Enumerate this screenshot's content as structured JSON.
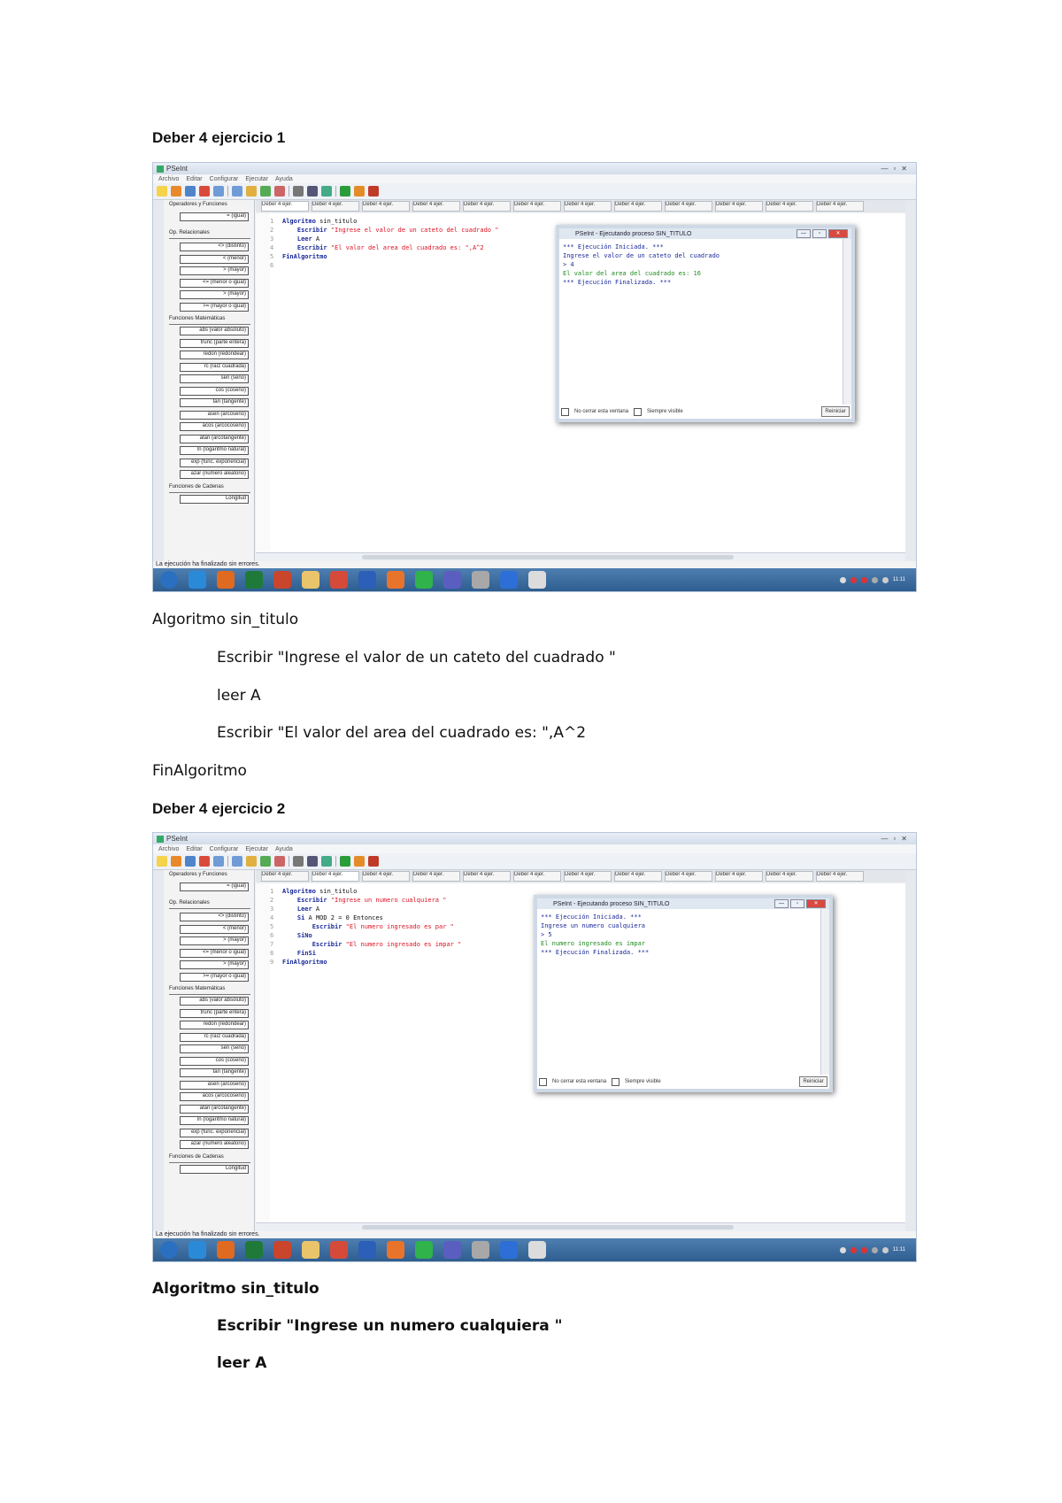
{
  "heading1": "Deber 4 ejercicio 1",
  "heading2": "Deber 4 ejercicio 2",
  "shot1": {
    "app_title": "PSeInt",
    "window_controls": [
      "—",
      "▫",
      "✕"
    ],
    "menu": [
      "Archivo",
      "Editar",
      "Configurar",
      "Ejecutar",
      "Ayuda"
    ],
    "tabs": [
      "Deber 4 ejer.",
      "Deber 4 ejer.",
      "Deber 4 ejer.",
      "Deber 4 ejer.",
      "Deber 4 ejer.",
      "Deber 4 ejer.",
      "Deber 4 ejer.",
      "Deber 4 ejer.",
      "Deber 4 ejer.",
      "Deber 4 ejer.",
      "Deber 4 ejer.",
      "Deber 4 ejer."
    ],
    "panel_title": "Operadores y Funciones",
    "group1": "Op. Relacionales",
    "group2": "Funciones Matemáticas",
    "group3": "Funciones de Cadenas",
    "ops": [
      "= (igual)",
      "<> (distinto)",
      "< (menor)",
      "> (mayor)",
      "<= (menor o igual)",
      "> (mayor)",
      ">= (mayor o igual)"
    ],
    "math": [
      "abs (valor absoluto)",
      "trunc (parte entera)",
      "redon (redondear)",
      "rc (raíz cuadrada)",
      "sen (seno)",
      "cos (coseno)",
      "tan (tangente)",
      "asen (arcoseno)",
      "acos (arcocoseno)",
      "atan (arcotangente)",
      "ln (logaritmo natural)",
      "exp (func. exponencial)",
      "azar (número aleatorio)"
    ],
    "strfn": [
      "Longitud"
    ],
    "code": [
      {
        "n": "1",
        "kw": "Algoritmo",
        "rest": " sin_titulo",
        "str": ""
      },
      {
        "n": "2",
        "kw": "    Escribir",
        "rest": " ",
        "str": "\"Ingrese el valor de un cateto del cuadrado \""
      },
      {
        "n": "3",
        "kw": "    Leer",
        "rest": " A",
        "str": ""
      },
      {
        "n": "4",
        "kw": "    Escribir",
        "rest": " ",
        "str": "\"El valor del area del cuadrado es: \",A^2"
      },
      {
        "n": "5",
        "kw": "FinAlgoritmo",
        "rest": "",
        "str": ""
      },
      {
        "n": "6",
        "kw": "",
        "rest": "",
        "str": ""
      }
    ],
    "run_title": "PSeInt - Ejecutando proceso SIN_TITULO",
    "run_lines": [
      "*** Ejecución Iniciada. ***",
      "Ingrese el valor de un cateto del cuadrado",
      "> 4",
      "El valor del area del cuadrado es: 16",
      "*** Ejecución Finalizada. ***"
    ],
    "run_check1": "No cerrar esta ventana",
    "run_check2": "Siempre visible",
    "run_button": "Reiniciar",
    "status": "La ejecución ha finalizado sin errores.",
    "clock": "11:11"
  },
  "shot2": {
    "app_title": "PSeInt",
    "window_controls": [
      "—",
      "▫",
      "✕"
    ],
    "menu": [
      "Archivo",
      "Editar",
      "Configurar",
      "Ejecutar",
      "Ayuda"
    ],
    "tabs": [
      "Deber 4 ejer.",
      "Deber 4 ejer.",
      "Deber 4 ejer.",
      "Deber 4 ejer.",
      "Deber 4 ejer.",
      "Deber 4 ejer.",
      "Deber 4 ejer.",
      "Deber 4 ejer.",
      "Deber 4 ejer.",
      "Deber 4 ejer.",
      "Deber 4 ejer.",
      "Deber 4 ejer."
    ],
    "panel_title": "Operadores y Funciones",
    "group1": "Op. Relacionales",
    "group2": "Funciones Matemáticas",
    "group3": "Funciones de Cadenas",
    "ops": [
      "= (igual)",
      "<> (distinto)",
      "< (menor)",
      "> (mayor)",
      "<= (menor o igual)",
      "> (mayor)",
      ">= (mayor o igual)"
    ],
    "math": [
      "abs (valor absoluto)",
      "trunc (parte entera)",
      "redon (redondear)",
      "rc (raíz cuadrada)",
      "sen (seno)",
      "cos (coseno)",
      "tan (tangente)",
      "asen (arcoseno)",
      "acos (arcocoseno)",
      "atan (arcotangente)",
      "ln (logaritmo natural)",
      "exp (func. exponencial)",
      "azar (número aleatorio)"
    ],
    "strfn": [
      "Longitud"
    ],
    "code": [
      {
        "n": "1",
        "kw": "Algoritmo",
        "rest": " sin_titulo",
        "str": ""
      },
      {
        "n": "2",
        "kw": "    Escribir",
        "rest": " ",
        "str": "\"Ingrese un numero cualquiera \""
      },
      {
        "n": "3",
        "kw": "    Leer",
        "rest": " A",
        "str": ""
      },
      {
        "n": "4",
        "kw": "    Si",
        "rest": " A MOD 2 = 0 Entonces",
        "str": ""
      },
      {
        "n": "5",
        "kw": "        Escribir",
        "rest": " ",
        "str": "\"El numero ingresado es par \""
      },
      {
        "n": "6",
        "kw": "    SiNo",
        "rest": "",
        "str": ""
      },
      {
        "n": "7",
        "kw": "        Escribir",
        "rest": " ",
        "str": "\"El numero ingresado es impar \""
      },
      {
        "n": "8",
        "kw": "    FinSi",
        "rest": "",
        "str": ""
      },
      {
        "n": "9",
        "kw": "FinAlgoritmo",
        "rest": "",
        "str": ""
      }
    ],
    "run_title": "PSeInt - Ejecutando proceso SIN_TITULO",
    "run_lines": [
      "*** Ejecución Iniciada. ***",
      "Ingrese un numero cualquiera",
      "> 5",
      "El numero ingresado es impar",
      "*** Ejecución Finalizada. ***"
    ],
    "run_check1": "No cerrar esta ventana",
    "run_check2": "Siempre visible",
    "run_button": "Reiniciar",
    "status": "La ejecución ha finalizado sin errores.",
    "clock": "11:11"
  },
  "code1": {
    "l1": "Algoritmo sin_titulo",
    "l2": "Escribir \"Ingrese el valor de un cateto del cuadrado \"",
    "l3": "leer A",
    "l4": "Escribir \"El valor del area del cuadrado es: \",A^2",
    "l5": "FinAlgoritmo"
  },
  "code2": {
    "l1": "Algoritmo sin_titulo",
    "l2": "Escribir \"Ingrese un numero cualquiera \"",
    "l3": "leer A"
  },
  "taskbar_icons": [
    "start-orb",
    "ie",
    "media",
    "excel",
    "powerpoint",
    "explorer",
    "chrome",
    "word",
    "firefox",
    "whatsapp",
    "teams",
    "app",
    "pseint",
    "app2"
  ]
}
